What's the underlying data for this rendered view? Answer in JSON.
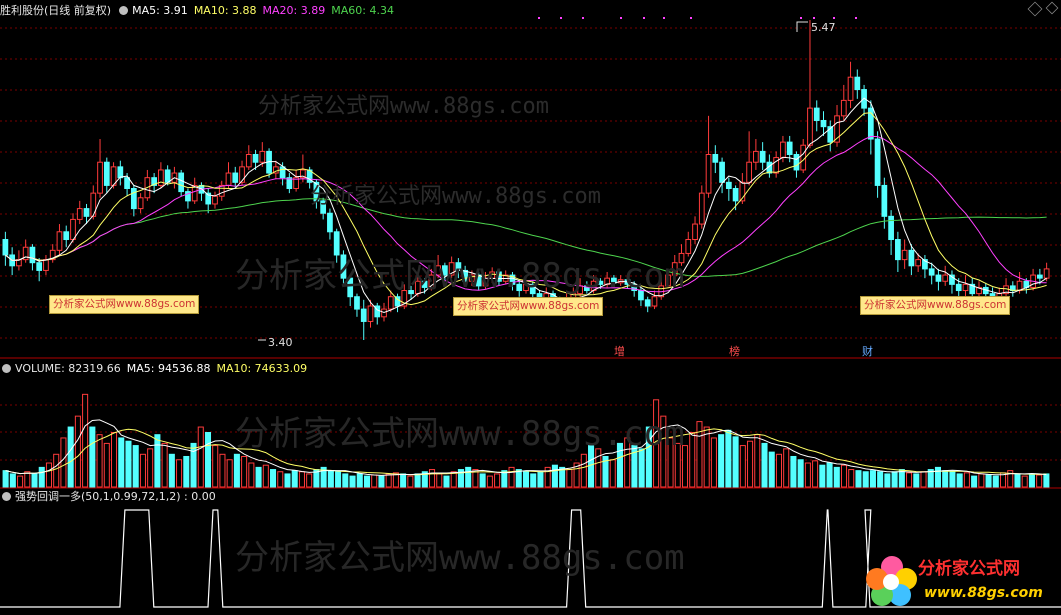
{
  "colors": {
    "up": "#ff3b3b",
    "down": "#54ffff",
    "ma5": "#ffffff",
    "ma10": "#ffff66",
    "ma20": "#ff40ff",
    "ma60": "#4ed44e",
    "grid": "#7a0000",
    "signal": "#ffffff"
  },
  "price_panel": {
    "title": "胜利股份(日线 前复权)",
    "ma5": "MA5: 3.91",
    "ma10": "MA10: 3.88",
    "ma20": "MA20: 3.89",
    "ma60": "MA60: 4.34",
    "high_label": "5.47",
    "low_label": "3.40",
    "events": [
      "增",
      "榜",
      "财"
    ]
  },
  "volume_panel": {
    "title": "VOLUME: 82319.66",
    "ma5": "MA5: 94536.88",
    "ma10": "MA10: 74633.09"
  },
  "indicator_panel": {
    "title": "强势回调一多(50,1,0.99,72,1,2) : 0.00"
  },
  "watermarks": {
    "text": "分析家公式网www.88gs.com",
    "badge": "分析家公式网www.88gs.com"
  },
  "logo": {
    "name": "分析家公式网",
    "url": "www.88gs.com"
  },
  "chart_data": {
    "type": "candlestick",
    "price_range": [
      3.4,
      5.47
    ],
    "candles": [
      [
        4.05,
        3.95,
        4.1,
        3.88
      ],
      [
        3.95,
        3.88,
        4.0,
        3.82
      ],
      [
        3.88,
        3.92,
        3.98,
        3.85
      ],
      [
        3.92,
        4.0,
        4.05,
        3.9
      ],
      [
        4.0,
        3.9,
        4.02,
        3.85
      ],
      [
        3.9,
        3.85,
        3.93,
        3.78
      ],
      [
        3.85,
        3.92,
        3.95,
        3.82
      ],
      [
        3.92,
        3.98,
        4.02,
        3.9
      ],
      [
        3.98,
        4.1,
        4.15,
        3.95
      ],
      [
        4.1,
        4.05,
        4.14,
        4.0
      ],
      [
        4.05,
        4.18,
        4.22,
        4.03
      ],
      [
        4.18,
        4.25,
        4.3,
        4.15
      ],
      [
        4.25,
        4.2,
        4.28,
        4.15
      ],
      [
        4.2,
        4.35,
        4.4,
        4.18
      ],
      [
        4.35,
        4.55,
        4.7,
        4.32
      ],
      [
        4.55,
        4.4,
        4.58,
        4.35
      ],
      [
        4.4,
        4.52,
        4.55,
        4.38
      ],
      [
        4.52,
        4.45,
        4.56,
        4.4
      ],
      [
        4.45,
        4.38,
        4.48,
        4.33
      ],
      [
        4.38,
        4.25,
        4.4,
        4.2
      ],
      [
        4.25,
        4.32,
        4.35,
        4.22
      ],
      [
        4.32,
        4.45,
        4.5,
        4.3
      ],
      [
        4.45,
        4.4,
        4.48,
        4.35
      ],
      [
        4.4,
        4.5,
        4.55,
        4.38
      ],
      [
        4.5,
        4.42,
        4.53,
        4.4
      ],
      [
        4.42,
        4.48,
        4.52,
        4.38
      ],
      [
        4.48,
        4.36,
        4.5,
        4.33
      ],
      [
        4.36,
        4.3,
        4.38,
        4.25
      ],
      [
        4.3,
        4.4,
        4.45,
        4.28
      ],
      [
        4.4,
        4.35,
        4.42,
        4.3
      ],
      [
        4.35,
        4.28,
        4.38,
        4.22
      ],
      [
        4.28,
        4.33,
        4.36,
        4.25
      ],
      [
        4.33,
        4.4,
        4.43,
        4.3
      ],
      [
        4.4,
        4.48,
        4.55,
        4.38
      ],
      [
        4.48,
        4.42,
        4.52,
        4.38
      ],
      [
        4.42,
        4.52,
        4.56,
        4.4
      ],
      [
        4.52,
        4.6,
        4.66,
        4.5
      ],
      [
        4.6,
        4.55,
        4.63,
        4.5
      ],
      [
        4.55,
        4.62,
        4.68,
        4.52
      ],
      [
        4.62,
        4.48,
        4.64,
        4.45
      ],
      [
        4.48,
        4.52,
        4.56,
        4.44
      ],
      [
        4.52,
        4.45,
        4.55,
        4.4
      ],
      [
        4.45,
        4.38,
        4.48,
        4.35
      ],
      [
        4.38,
        4.45,
        4.5,
        4.36
      ],
      [
        4.45,
        4.5,
        4.6,
        4.42
      ],
      [
        4.5,
        4.42,
        4.52,
        4.38
      ],
      [
        4.42,
        4.3,
        4.44,
        4.25
      ],
      [
        4.3,
        4.22,
        4.32,
        4.18
      ],
      [
        4.22,
        4.1,
        4.25,
        4.05
      ],
      [
        4.1,
        3.95,
        4.12,
        3.9
      ],
      [
        3.95,
        3.8,
        3.98,
        3.75
      ],
      [
        3.8,
        3.68,
        3.82,
        3.62
      ],
      [
        3.68,
        3.6,
        3.7,
        3.55
      ],
      [
        3.6,
        3.52,
        3.66,
        3.4
      ],
      [
        3.52,
        3.62,
        3.66,
        3.48
      ],
      [
        3.62,
        3.55,
        3.64,
        3.5
      ],
      [
        3.55,
        3.6,
        3.64,
        3.52
      ],
      [
        3.6,
        3.68,
        3.72,
        3.58
      ],
      [
        3.68,
        3.62,
        3.7,
        3.58
      ],
      [
        3.62,
        3.72,
        3.76,
        3.6
      ],
      [
        3.72,
        3.7,
        3.75,
        3.66
      ],
      [
        3.7,
        3.78,
        3.82,
        3.68
      ],
      [
        3.78,
        3.74,
        3.8,
        3.7
      ],
      [
        3.74,
        3.82,
        3.86,
        3.72
      ],
      [
        3.82,
        3.88,
        3.95,
        3.8
      ],
      [
        3.88,
        3.82,
        3.9,
        3.78
      ],
      [
        3.82,
        3.9,
        3.94,
        3.8
      ],
      [
        3.9,
        3.85,
        3.93,
        3.8
      ],
      [
        3.85,
        3.78,
        3.88,
        3.75
      ],
      [
        3.78,
        3.82,
        3.85,
        3.75
      ],
      [
        3.82,
        3.75,
        3.84,
        3.72
      ],
      [
        3.75,
        3.8,
        3.84,
        3.73
      ],
      [
        3.8,
        3.84,
        3.87,
        3.77
      ],
      [
        3.84,
        3.78,
        3.86,
        3.75
      ],
      [
        3.78,
        3.82,
        3.85,
        3.76
      ],
      [
        3.82,
        3.76,
        3.84,
        3.72
      ],
      [
        3.76,
        3.72,
        3.78,
        3.68
      ],
      [
        3.72,
        3.76,
        3.8,
        3.7
      ],
      [
        3.76,
        3.7,
        3.78,
        3.66
      ],
      [
        3.7,
        3.66,
        3.72,
        3.62
      ],
      [
        3.66,
        3.7,
        3.74,
        3.64
      ],
      [
        3.7,
        3.65,
        3.72,
        3.62
      ],
      [
        3.65,
        3.62,
        3.68,
        3.58
      ],
      [
        3.62,
        3.66,
        3.7,
        3.6
      ],
      [
        3.66,
        3.7,
        3.74,
        3.64
      ],
      [
        3.7,
        3.75,
        3.8,
        3.68
      ],
      [
        3.75,
        3.72,
        3.78,
        3.7
      ],
      [
        3.72,
        3.78,
        3.82,
        3.7
      ],
      [
        3.78,
        3.76,
        3.8,
        3.73
      ],
      [
        3.76,
        3.8,
        3.84,
        3.74
      ],
      [
        3.8,
        3.77,
        3.82,
        3.75
      ],
      [
        3.77,
        3.79,
        3.82,
        3.75
      ],
      [
        3.79,
        3.76,
        3.8,
        3.73
      ],
      [
        3.76,
        3.72,
        3.78,
        3.68
      ],
      [
        3.72,
        3.66,
        3.74,
        3.62
      ],
      [
        3.66,
        3.62,
        3.68,
        3.58
      ],
      [
        3.62,
        3.68,
        3.72,
        3.6
      ],
      [
        3.68,
        3.75,
        3.8,
        3.66
      ],
      [
        3.75,
        3.82,
        3.86,
        3.74
      ],
      [
        3.82,
        3.9,
        3.95,
        3.8
      ],
      [
        3.9,
        3.96,
        4.02,
        3.88
      ],
      [
        3.96,
        4.05,
        4.1,
        3.94
      ],
      [
        4.05,
        4.15,
        4.2,
        4.02
      ],
      [
        4.15,
        4.35,
        4.4,
        4.12
      ],
      [
        4.35,
        4.6,
        4.85,
        4.32
      ],
      [
        4.6,
        4.55,
        4.66,
        4.48
      ],
      [
        4.55,
        4.42,
        4.58,
        4.35
      ],
      [
        4.42,
        4.38,
        4.45,
        4.3
      ],
      [
        4.38,
        4.3,
        4.4,
        4.24
      ],
      [
        4.3,
        4.42,
        4.48,
        4.28
      ],
      [
        4.42,
        4.55,
        4.75,
        4.4
      ],
      [
        4.55,
        4.62,
        4.7,
        4.5
      ],
      [
        4.62,
        4.55,
        4.68,
        4.5
      ],
      [
        4.55,
        4.48,
        4.6,
        4.45
      ],
      [
        4.48,
        4.58,
        4.62,
        4.45
      ],
      [
        4.58,
        4.68,
        4.72,
        4.55
      ],
      [
        4.68,
        4.6,
        4.72,
        4.55
      ],
      [
        4.6,
        4.5,
        4.62,
        4.45
      ],
      [
        4.5,
        4.66,
        4.7,
        4.48
      ],
      [
        4.66,
        4.9,
        5.47,
        4.64
      ],
      [
        4.9,
        4.82,
        4.95,
        4.75
      ],
      [
        4.82,
        4.78,
        4.88,
        4.72
      ],
      [
        4.78,
        4.68,
        4.82,
        4.62
      ],
      [
        4.68,
        4.85,
        4.92,
        4.65
      ],
      [
        4.85,
        4.95,
        5.05,
        4.82
      ],
      [
        4.95,
        5.1,
        5.2,
        4.9
      ],
      [
        5.1,
        5.02,
        5.15,
        4.96
      ],
      [
        5.02,
        4.9,
        5.05,
        4.85
      ],
      [
        4.9,
        4.7,
        4.95,
        4.6
      ],
      [
        4.7,
        4.4,
        4.75,
        4.32
      ],
      [
        4.4,
        4.2,
        4.45,
        4.12
      ],
      [
        4.2,
        4.05,
        4.24,
        3.95
      ],
      [
        4.05,
        3.92,
        4.1,
        3.84
      ],
      [
        3.92,
        3.98,
        4.05,
        3.86
      ],
      [
        3.98,
        3.88,
        4.02,
        3.82
      ],
      [
        3.88,
        3.92,
        3.96,
        3.84
      ],
      [
        3.92,
        3.86,
        3.95,
        3.8
      ],
      [
        3.86,
        3.82,
        3.9,
        3.76
      ],
      [
        3.82,
        3.78,
        3.86,
        3.72
      ],
      [
        3.78,
        3.82,
        3.88,
        3.75
      ],
      [
        3.82,
        3.76,
        3.85,
        3.7
      ],
      [
        3.76,
        3.72,
        3.8,
        3.66
      ],
      [
        3.72,
        3.76,
        3.82,
        3.68
      ],
      [
        3.76,
        3.7,
        3.8,
        3.64
      ],
      [
        3.7,
        3.74,
        3.78,
        3.66
      ],
      [
        3.74,
        3.7,
        3.77,
        3.65
      ],
      [
        3.7,
        3.66,
        3.74,
        3.62
      ],
      [
        3.66,
        3.7,
        3.74,
        3.64
      ],
      [
        3.7,
        3.75,
        3.8,
        3.68
      ],
      [
        3.75,
        3.72,
        3.78,
        3.68
      ],
      [
        3.72,
        3.78,
        3.84,
        3.7
      ],
      [
        3.78,
        3.74,
        3.8,
        3.7
      ],
      [
        3.74,
        3.82,
        3.86,
        3.72
      ],
      [
        3.82,
        3.8,
        3.86,
        3.76
      ],
      [
        3.8,
        3.86,
        3.9,
        3.78
      ]
    ],
    "volume_levels": [
      0.15,
      0.12,
      0.1,
      0.14,
      0.12,
      0.18,
      0.22,
      0.3,
      0.45,
      0.55,
      0.65,
      0.85,
      0.55,
      0.48,
      0.4,
      0.5,
      0.45,
      0.42,
      0.38,
      0.3,
      0.35,
      0.48,
      0.4,
      0.3,
      0.25,
      0.28,
      0.4,
      0.55,
      0.5,
      0.38,
      0.3,
      0.25,
      0.3,
      0.28,
      0.22,
      0.18,
      0.2,
      0.16,
      0.14,
      0.12,
      0.15,
      0.14,
      0.12,
      0.16,
      0.18,
      0.15,
      0.14,
      0.12,
      0.1,
      0.12,
      0.1,
      0.11,
      0.1,
      0.12,
      0.13,
      0.12,
      0.1,
      0.12,
      0.14,
      0.16,
      0.12,
      0.1,
      0.14,
      0.16,
      0.18,
      0.16,
      0.12,
      0.1,
      0.12,
      0.15,
      0.18,
      0.16,
      0.14,
      0.12,
      0.14,
      0.18,
      0.2,
      0.18,
      0.16,
      0.22,
      0.3,
      0.38,
      0.35,
      0.28,
      0.25,
      0.4,
      0.45,
      0.38,
      0.35,
      0.55,
      0.8,
      0.65,
      0.45,
      0.4,
      0.38,
      0.5,
      0.6,
      0.55,
      0.45,
      0.48,
      0.52,
      0.46,
      0.38,
      0.42,
      0.48,
      0.4,
      0.32,
      0.3,
      0.35,
      0.28,
      0.25,
      0.22,
      0.24,
      0.2,
      0.22,
      0.18,
      0.2,
      0.16,
      0.15,
      0.14,
      0.15,
      0.14,
      0.12,
      0.14,
      0.16,
      0.13,
      0.12,
      0.14,
      0.16,
      0.18,
      0.15,
      0.14,
      0.12,
      0.13,
      0.1,
      0.12,
      0.11,
      0.1,
      0.13,
      0.15,
      0.12,
      0.1,
      0.12,
      0.11,
      0.12
    ],
    "signal_pulses": [
      [
        0.113,
        0.145
      ],
      [
        0.196,
        0.21
      ],
      [
        0.534,
        0.552
      ],
      [
        0.775,
        0.785
      ],
      [
        0.816,
        0.82
      ]
    ]
  }
}
